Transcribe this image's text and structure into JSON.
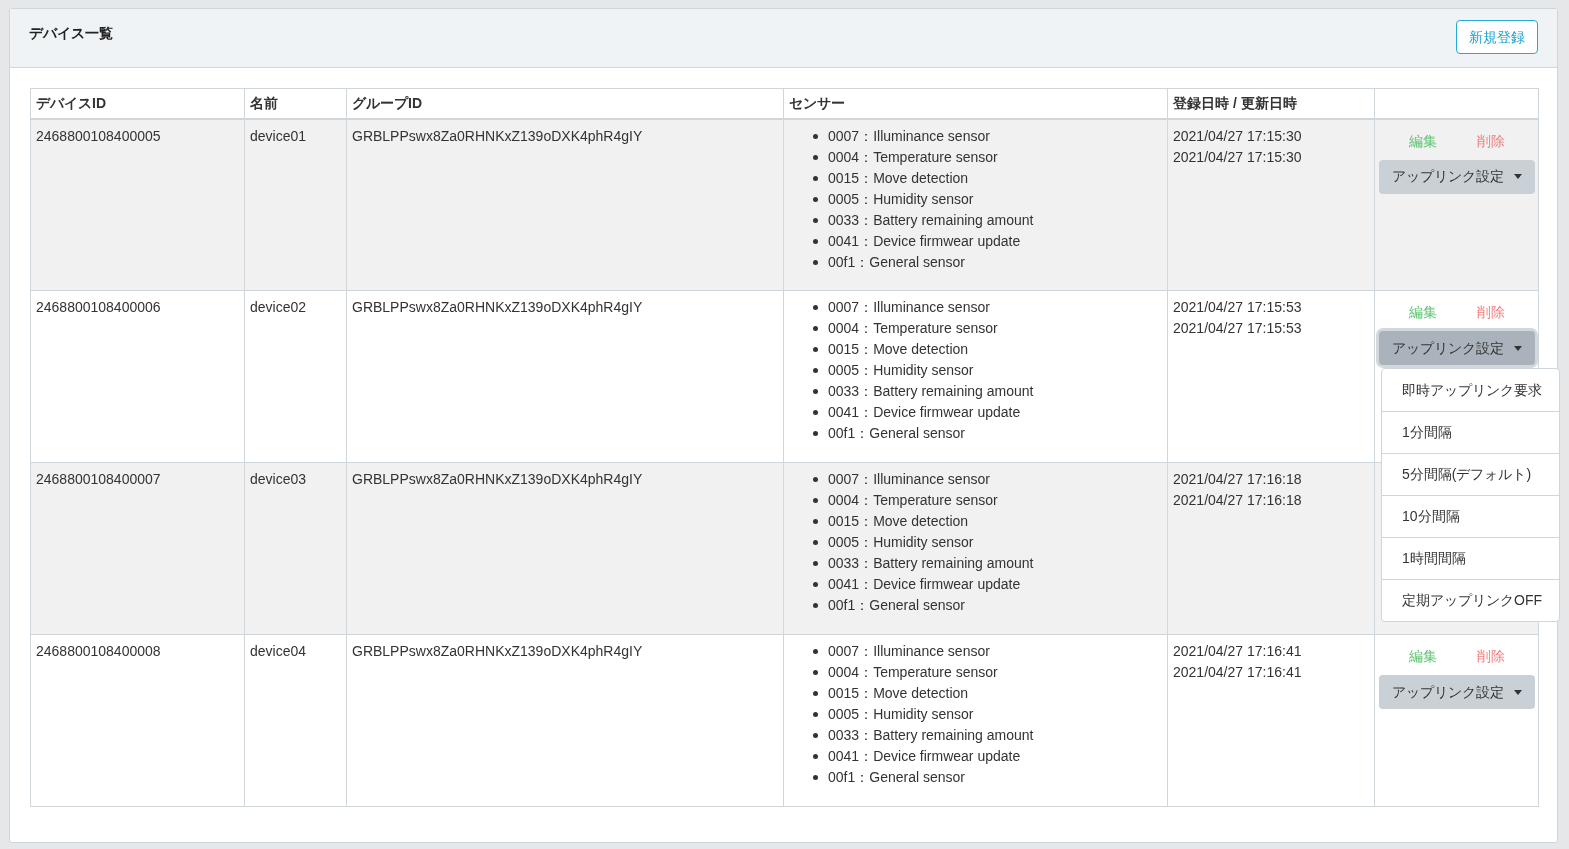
{
  "card": {
    "title": "デバイス一覧",
    "new_button": "新規登録"
  },
  "table": {
    "columns": [
      "デバイスID",
      "名前",
      "グループID",
      "センサー",
      "登録日時 / 更新日時"
    ],
    "rows": [
      {
        "device_id": "2468800108400005",
        "name": "device01",
        "group_id": "GRBLPPswx8Za0RHNKxZ139oDXK4phR4gIY",
        "sensors": [
          "0007：Illuminance sensor",
          "0004：Temperature sensor",
          "0015：Move detection",
          "0005：Humidity sensor",
          "0033：Battery remaining amount",
          "0041：Device firmwear update",
          "00f1：General sensor"
        ],
        "registered": "2021/04/27 17:15:30",
        "updated": "2021/04/27 17:15:30",
        "edit": "編集",
        "delete": "削除",
        "uplink": "アップリンク設定",
        "menu_open": false
      },
      {
        "device_id": "2468800108400006",
        "name": "device02",
        "group_id": "GRBLPPswx8Za0RHNKxZ139oDXK4phR4gIY",
        "sensors": [
          "0007：Illuminance sensor",
          "0004：Temperature sensor",
          "0015：Move detection",
          "0005：Humidity sensor",
          "0033：Battery remaining amount",
          "0041：Device firmwear update",
          "00f1：General sensor"
        ],
        "registered": "2021/04/27 17:15:53",
        "updated": "2021/04/27 17:15:53",
        "edit": "編集",
        "delete": "削除",
        "uplink": "アップリンク設定",
        "menu_open": true
      },
      {
        "device_id": "2468800108400007",
        "name": "device03",
        "group_id": "GRBLPPswx8Za0RHNKxZ139oDXK4phR4gIY",
        "sensors": [
          "0007：Illuminance sensor",
          "0004：Temperature sensor",
          "0015：Move detection",
          "0005：Humidity sensor",
          "0033：Battery remaining amount",
          "0041：Device firmwear update",
          "00f1：General sensor"
        ],
        "registered": "2021/04/27 17:16:18",
        "updated": "2021/04/27 17:16:18"
      },
      {
        "device_id": "2468800108400008",
        "name": "device04",
        "group_id": "GRBLPPswx8Za0RHNKxZ139oDXK4phR4gIY",
        "sensors": [
          "0007：Illuminance sensor",
          "0004：Temperature sensor",
          "0015：Move detection",
          "0005：Humidity sensor",
          "0033：Battery remaining amount",
          "0041：Device firmwear update",
          "00f1：General sensor"
        ],
        "registered": "2021/04/27 17:16:41",
        "updated": "2021/04/27 17:16:41",
        "edit": "編集",
        "delete": "削除",
        "uplink": "アップリンク設定",
        "menu_open": false
      }
    ]
  },
  "uplink_menu": [
    "即時アップリンク要求",
    "1分間隔",
    "5分間隔(デフォルト)",
    "10分間隔",
    "1時間間隔",
    "定期アップリンクOFF"
  ]
}
